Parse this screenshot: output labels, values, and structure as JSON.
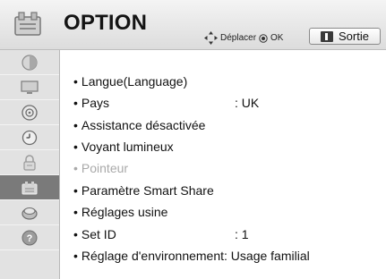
{
  "header": {
    "title": "OPTION",
    "nav_hint_move": "Déplacer",
    "nav_hint_ok": "OK",
    "exit_label": "Sortie"
  },
  "sidebar": {
    "items": [
      {
        "icon": "image-settings-icon",
        "active": false
      },
      {
        "icon": "tv-screen-icon",
        "active": false
      },
      {
        "icon": "speaker-icon",
        "active": false
      },
      {
        "icon": "clock-icon",
        "active": false
      },
      {
        "icon": "lock-icon",
        "active": false
      },
      {
        "icon": "option-icon",
        "active": true
      },
      {
        "icon": "network-globe-icon",
        "active": false
      },
      {
        "icon": "help-icon",
        "active": false
      }
    ]
  },
  "menu": {
    "items": [
      {
        "label": "Langue(Language)",
        "value": "",
        "disabled": false
      },
      {
        "label": "Pays",
        "value": ": UK",
        "disabled": false
      },
      {
        "label": "Assistance désactivée",
        "value": "",
        "disabled": false
      },
      {
        "label": "Voyant lumineux",
        "value": "",
        "disabled": false
      },
      {
        "label": "Pointeur",
        "value": "",
        "disabled": true
      },
      {
        "label": "Paramètre Smart Share",
        "value": "",
        "disabled": false
      },
      {
        "label": "Réglages usine",
        "value": "",
        "disabled": false
      },
      {
        "label": "Set ID",
        "value": ": 1",
        "disabled": false
      },
      {
        "label": "Réglage d'environnement: Usage familial",
        "value": "",
        "disabled": false
      }
    ]
  }
}
